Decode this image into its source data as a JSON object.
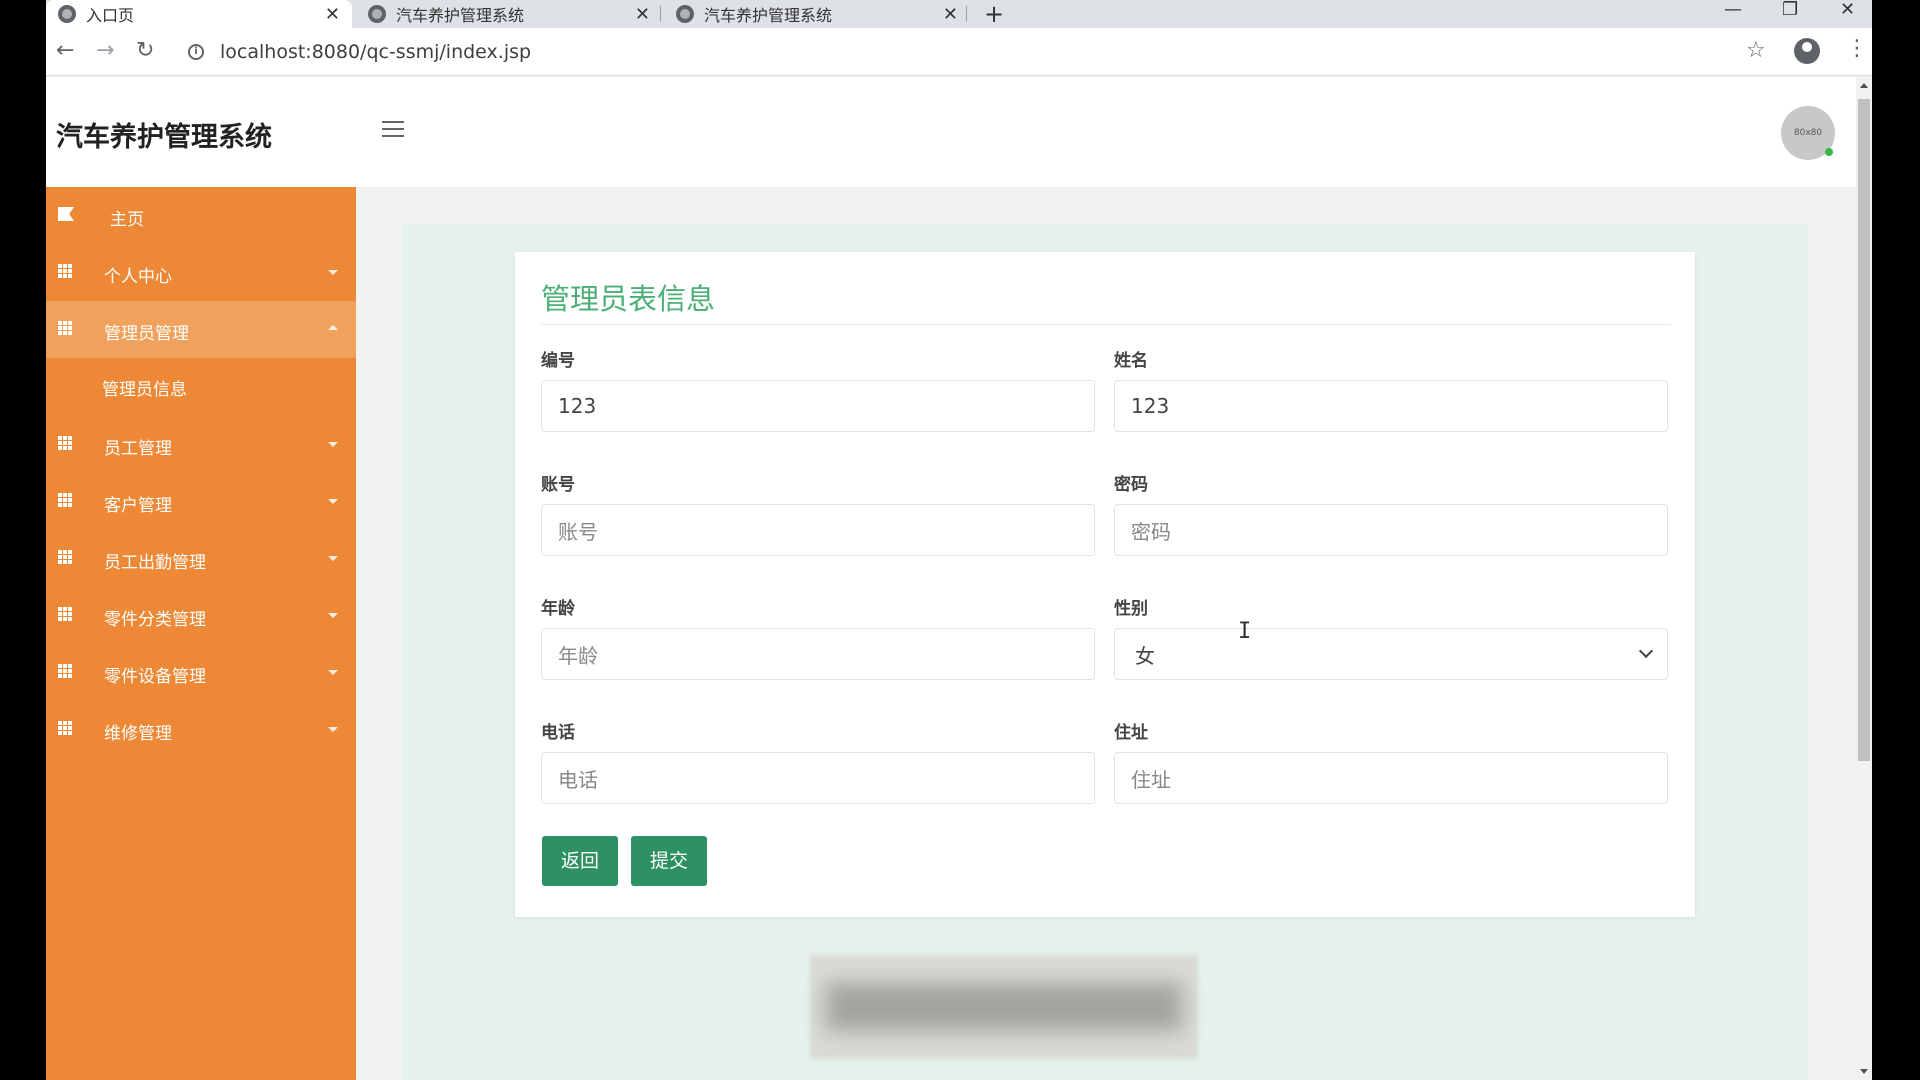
{
  "browser": {
    "tabs": [
      {
        "title": "入口页",
        "active": true
      },
      {
        "title": "汽车养护管理系统",
        "active": false
      },
      {
        "title": "汽车养护管理系统",
        "active": false
      }
    ],
    "url": "localhost:8080/qc-ssmj/index.jsp"
  },
  "header": {
    "brand": "汽车养护管理系统",
    "avatar_text": "80x80"
  },
  "sidebar": {
    "items": [
      {
        "label": "主页",
        "icon": "flag-icon"
      },
      {
        "label": "个人中心",
        "icon": "grid-icon"
      },
      {
        "label": "管理员管理",
        "icon": "grid-icon",
        "expanded": true
      },
      {
        "label": "员工管理",
        "icon": "grid-icon"
      },
      {
        "label": "客户管理",
        "icon": "grid-icon"
      },
      {
        "label": "员工出勤管理",
        "icon": "grid-icon"
      },
      {
        "label": "零件分类管理",
        "icon": "grid-icon"
      },
      {
        "label": "零件设备管理",
        "icon": "grid-icon"
      },
      {
        "label": "维修管理",
        "icon": "grid-icon"
      }
    ],
    "sub_items": [
      {
        "label": "管理员信息"
      }
    ]
  },
  "form": {
    "title": "管理员表信息",
    "fields": {
      "id": {
        "label": "编号",
        "value": "123"
      },
      "name": {
        "label": "姓名",
        "value": "123"
      },
      "account": {
        "label": "账号",
        "placeholder": "账号"
      },
      "password": {
        "label": "密码",
        "placeholder": "密码"
      },
      "age": {
        "label": "年龄",
        "placeholder": "年龄"
      },
      "gender": {
        "label": "性别",
        "value": "女"
      },
      "phone": {
        "label": "电话",
        "placeholder": "电话"
      },
      "address": {
        "label": "住址",
        "placeholder": "住址"
      }
    },
    "buttons": {
      "back": "返回",
      "submit": "提交"
    }
  },
  "colors": {
    "sidebar": "#ed8936",
    "sidebar_active": "#f0a25c",
    "title_green": "#4caf78",
    "button_green": "#2e9163",
    "content_bg": "#e6f1ec"
  }
}
